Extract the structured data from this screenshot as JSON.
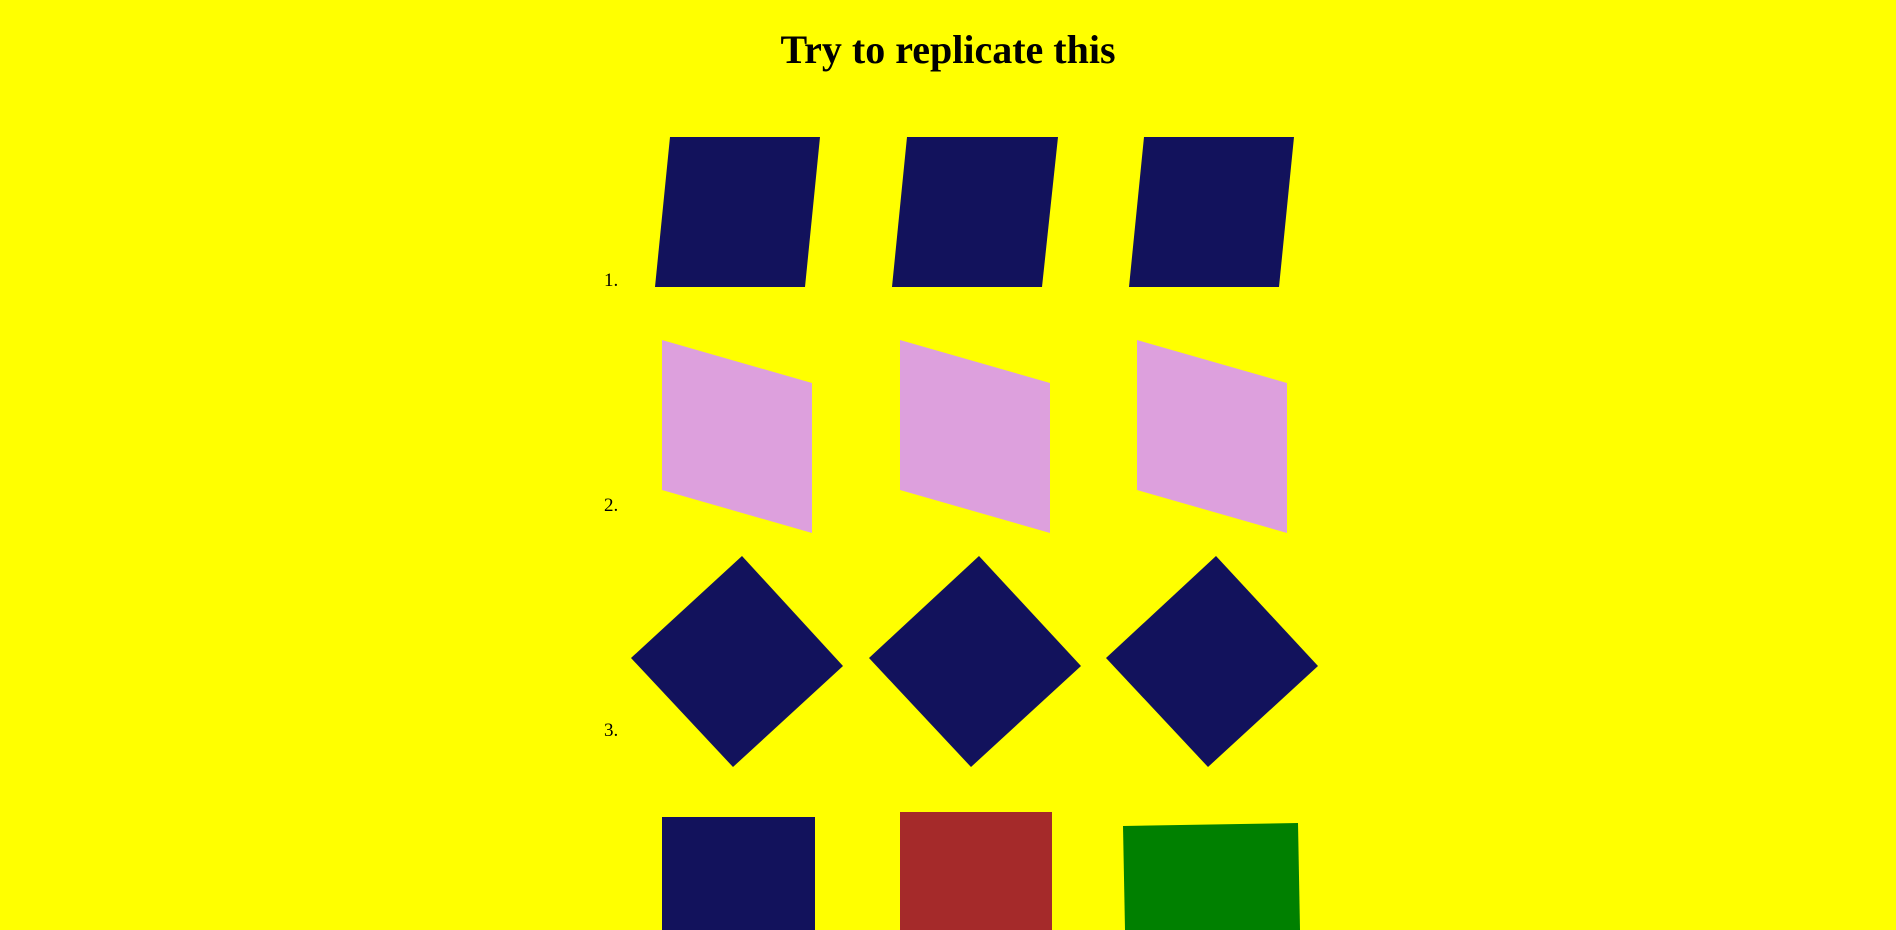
{
  "page": {
    "title": "Try to replicate this",
    "background_color": "#ffff00"
  },
  "rows": [
    {
      "label": "1.",
      "shape": "parallelogram",
      "items": [
        {
          "color": "#12125c"
        },
        {
          "color": "#12125c"
        },
        {
          "color": "#12125c"
        }
      ]
    },
    {
      "label": "2.",
      "shape": "parallelogram-slanted",
      "items": [
        {
          "color": "#dda0dd"
        },
        {
          "color": "#dda0dd"
        },
        {
          "color": "#dda0dd"
        }
      ]
    },
    {
      "label": "3.",
      "shape": "diamond",
      "items": [
        {
          "color": "#12125c"
        },
        {
          "color": "#12125c"
        },
        {
          "color": "#12125c"
        }
      ]
    },
    {
      "label": "",
      "shape": "square",
      "items": [
        {
          "color": "#12125c"
        },
        {
          "color": "#a52a2a"
        },
        {
          "color": "#008000"
        }
      ]
    }
  ]
}
